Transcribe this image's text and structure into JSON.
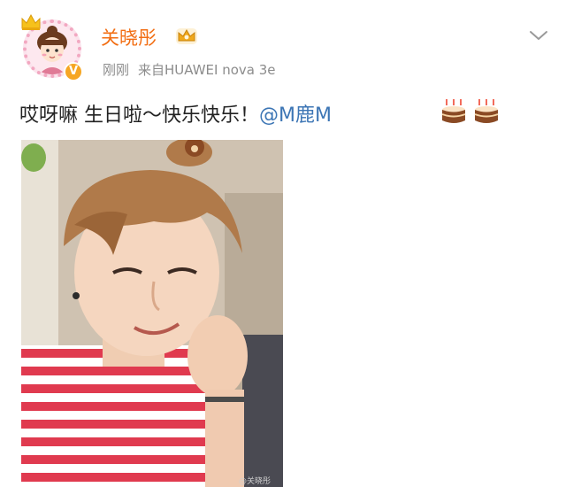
{
  "user": {
    "name": "关晓彤",
    "verified_badge": "V",
    "avatar_icon": "cartoon-girl-avatar",
    "crown_icon": "crown-icon",
    "vip_icon": "vip-crown-icon"
  },
  "meta": {
    "time": "刚刚",
    "source": "来自HUAWEI nova 3e"
  },
  "post": {
    "text": "哎呀嘛 生日啦～快乐快乐！",
    "mention": "@M鹿M",
    "emoji_icons": [
      "birthday-cake-icon",
      "birthday-cake-icon"
    ]
  },
  "photo": {
    "watermark": "@关晓彤"
  },
  "menu": {
    "icon": "chevron-down-icon"
  },
  "colors": {
    "username": "#f26d12",
    "mention": "#3d76b5",
    "meta": "#8c8c8c",
    "text": "#222222"
  }
}
